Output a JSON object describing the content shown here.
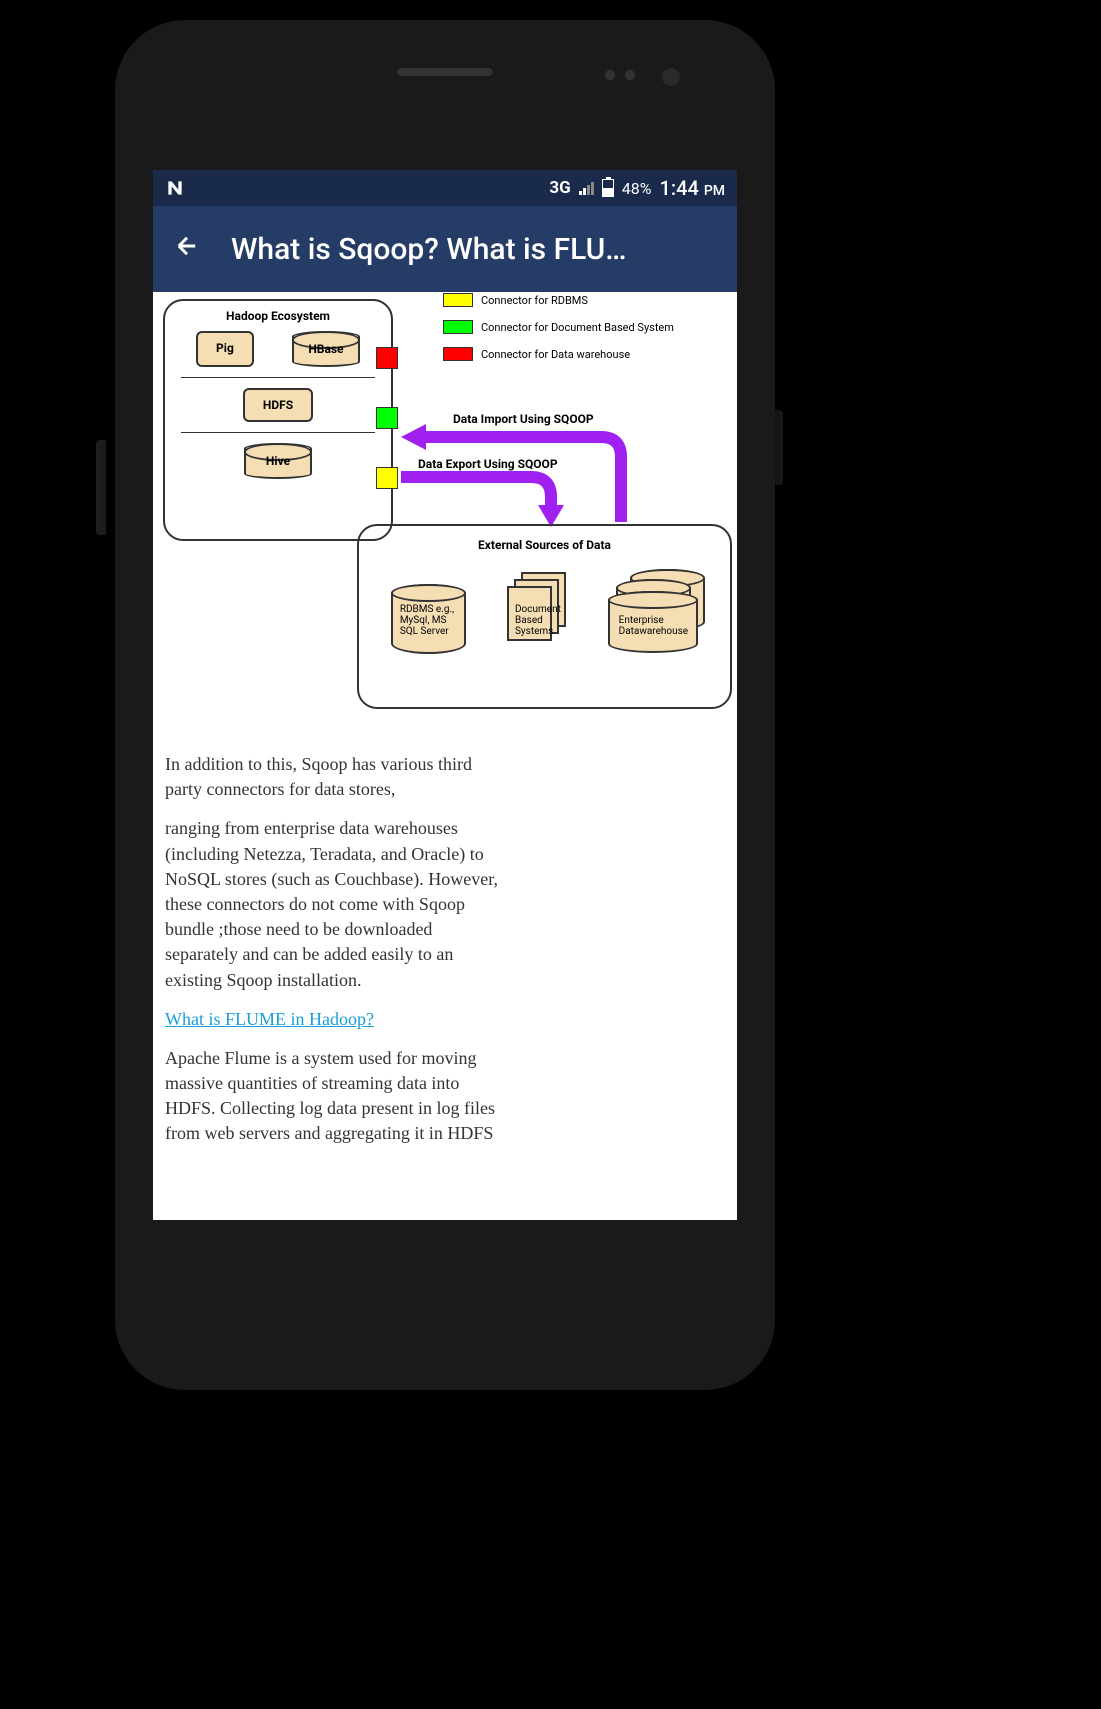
{
  "status_bar": {
    "network": "3G",
    "battery_pct": "48%",
    "time": "1:44",
    "time_suffix": "PM"
  },
  "app_bar": {
    "title": "What is Sqoop? What is FLU…"
  },
  "diagram": {
    "hadoop_label": "Hadoop Ecosystem",
    "pig": "Pig",
    "hbase": "HBase",
    "hdfs": "HDFS",
    "hive": "Hive",
    "legend1": "Connector for RDBMS",
    "legend2": "Connector for Document Based System",
    "legend3": "Connector for Data warehouse",
    "import_label": "Data Import Using SQOOP",
    "export_label": "Data Export Using SQOOP",
    "external_label": "External Sources of Data",
    "rdbms": "RDBMS e.g., MySql, MS SQL Server",
    "docsys": "Document Based Systems",
    "dw": "Enterprise Datawarehouse",
    "colors": {
      "yellow": "#ffff00",
      "green": "#00ff00",
      "red": "#ff0000",
      "purple": "#a020f0"
    }
  },
  "body": {
    "p1": "In addition to this, Sqoop has various third party connectors for data stores,",
    "p2": "ranging from enterprise data warehouses (including Netezza, Teradata, and Oracle) to NoSQL stores (such as Couchbase). However, these connectors do not come with Sqoop bundle ;those need to be downloaded separately and can be added easily to an existing Sqoop installation.",
    "link": "What is FLUME in Hadoop?",
    "p3": "Apache Flume is a system used for moving massive quantities of streaming data into HDFS. Collecting log data present in log files from web servers and aggregating it in HDFS"
  }
}
